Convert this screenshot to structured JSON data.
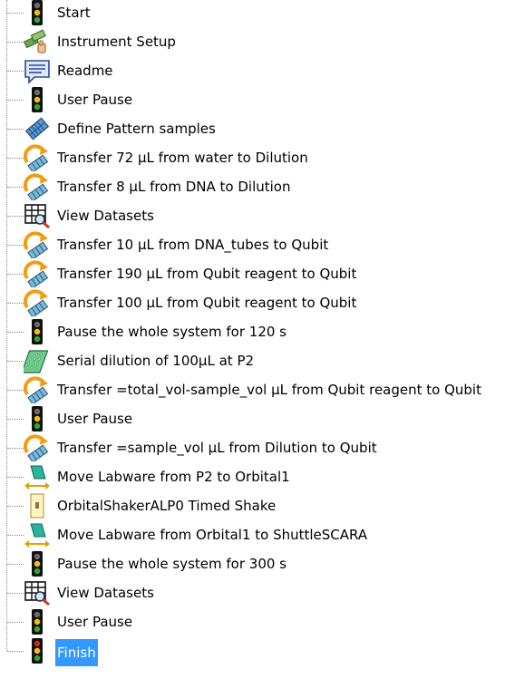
{
  "tree": {
    "items": [
      {
        "label": "Start",
        "icon": "traffic-light-icon"
      },
      {
        "label": "Instrument Setup",
        "icon": "instrument-setup-icon"
      },
      {
        "label": "Readme",
        "icon": "readme-icon"
      },
      {
        "label": "User Pause",
        "icon": "traffic-light-icon"
      },
      {
        "label": "Define Pattern samples",
        "icon": "define-pattern-icon"
      },
      {
        "label": "Transfer 72 µL from water to Dilution",
        "icon": "transfer-icon"
      },
      {
        "label": "Transfer 8 µL from DNA to Dilution",
        "icon": "transfer-icon"
      },
      {
        "label": "View Datasets",
        "icon": "view-datasets-icon"
      },
      {
        "label": "Transfer 10 µL from DNA_tubes to Qubit",
        "icon": "transfer-icon"
      },
      {
        "label": "Transfer 190 µL from Qubit reagent to Qubit",
        "icon": "transfer-icon"
      },
      {
        "label": "Transfer 100 µL from Qubit reagent to Qubit",
        "icon": "transfer-icon"
      },
      {
        "label": "Pause the whole system for 120 s",
        "icon": "traffic-light-icon"
      },
      {
        "label": "Serial dilution of 100µL at P2",
        "icon": "serial-dilution-icon"
      },
      {
        "label": "Transfer =total_vol-sample_vol µL from Qubit reagent to Qubit",
        "icon": "transfer-icon"
      },
      {
        "label": "User Pause",
        "icon": "traffic-light-icon"
      },
      {
        "label": "Transfer =sample_vol µL from Dilution to Qubit",
        "icon": "transfer-icon"
      },
      {
        "label": "Move Labware from P2 to Orbital1",
        "icon": "move-labware-icon"
      },
      {
        "label": "OrbitalShakerALP0 Timed Shake",
        "icon": "timed-shake-icon"
      },
      {
        "label": "Move Labware from Orbital1 to ShuttleSCARA",
        "icon": "move-labware-icon"
      },
      {
        "label": "Pause the whole system for 300 s",
        "icon": "traffic-light-icon"
      },
      {
        "label": "View Datasets",
        "icon": "view-datasets-icon"
      },
      {
        "label": "User Pause",
        "icon": "traffic-light-icon"
      },
      {
        "label": "Finish",
        "icon": "traffic-light-red-icon",
        "selected": true
      }
    ],
    "colors": {
      "selection": "#3399ff",
      "tree_line": "#8a8a8a"
    }
  }
}
